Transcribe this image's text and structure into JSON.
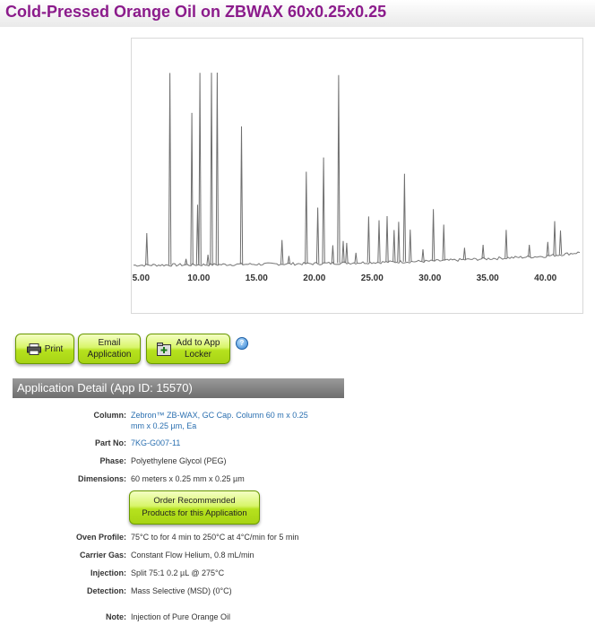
{
  "page": {
    "title": "Cold-Pressed Orange Oil on ZBWAX 60x0.25x0.25"
  },
  "colors": {
    "title": "#8b1b8b",
    "button_green": "#b6e21e",
    "header_gray": "#7a7a7a",
    "link": "#2a6fb0"
  },
  "chart_data": {
    "type": "line",
    "title": "",
    "xlabel": "",
    "ylabel": "",
    "xlim": [
      4.2,
      43.2
    ],
    "x_ticks": [
      "5.00",
      "10.00",
      "15.00",
      "20.00",
      "25.00",
      "30.00",
      "35.00",
      "40.00"
    ],
    "x_tick_values": [
      5,
      10,
      15,
      20,
      25,
      30,
      35,
      40
    ],
    "ylim": [
      0,
      100
    ],
    "grid": false,
    "baseline": [
      [
        4.2,
        1.0
      ],
      [
        10,
        1.2
      ],
      [
        20,
        1.8
      ],
      [
        30,
        3.0
      ],
      [
        40,
        5.5
      ],
      [
        43.2,
        7.5
      ]
    ],
    "peaks": [
      {
        "x": 5.5,
        "h": 16
      },
      {
        "x": 7.5,
        "h": 96
      },
      {
        "x": 8.9,
        "h": 3
      },
      {
        "x": 9.4,
        "h": 76
      },
      {
        "x": 9.9,
        "h": 30
      },
      {
        "x": 10.1,
        "h": 96
      },
      {
        "x": 10.8,
        "h": 5
      },
      {
        "x": 11.1,
        "h": 96
      },
      {
        "x": 11.6,
        "h": 96
      },
      {
        "x": 13.7,
        "h": 69
      },
      {
        "x": 17.2,
        "h": 12
      },
      {
        "x": 17.8,
        "h": 4
      },
      {
        "x": 19.3,
        "h": 46
      },
      {
        "x": 20.3,
        "h": 28
      },
      {
        "x": 20.8,
        "h": 53
      },
      {
        "x": 21.6,
        "h": 9
      },
      {
        "x": 22.1,
        "h": 94
      },
      {
        "x": 22.5,
        "h": 11
      },
      {
        "x": 22.8,
        "h": 10
      },
      {
        "x": 23.6,
        "h": 5
      },
      {
        "x": 24.7,
        "h": 23
      },
      {
        "x": 25.6,
        "h": 21
      },
      {
        "x": 26.3,
        "h": 23
      },
      {
        "x": 26.9,
        "h": 16
      },
      {
        "x": 27.3,
        "h": 20
      },
      {
        "x": 27.8,
        "h": 44
      },
      {
        "x": 28.3,
        "h": 16
      },
      {
        "x": 29.4,
        "h": 6
      },
      {
        "x": 30.3,
        "h": 26
      },
      {
        "x": 31.2,
        "h": 18
      },
      {
        "x": 33.0,
        "h": 6
      },
      {
        "x": 34.6,
        "h": 7
      },
      {
        "x": 36.6,
        "h": 14
      },
      {
        "x": 38.6,
        "h": 6
      },
      {
        "x": 40.2,
        "h": 7
      },
      {
        "x": 40.8,
        "h": 17
      },
      {
        "x": 41.3,
        "h": 12
      }
    ]
  },
  "toolbar": {
    "print_label": "Print",
    "print_icon": "printer-icon",
    "email_label_1": "Email",
    "email_label_2": "Application",
    "locker_label_1": "Add to App",
    "locker_label_2": "Locker",
    "locker_icon": "add-locker-icon",
    "help_icon": "help-icon",
    "help_glyph": "?"
  },
  "detail": {
    "header": "Application Detail (App ID: 15570)",
    "column_label": "Column:",
    "column_value_1": "Zebron™ ZB-WAX, GC Cap. Column 60 m x 0.25",
    "column_value_2": "mm x 0.25 µm, Ea",
    "partno_label": "Part No:",
    "partno_value": "7KG-G007-11",
    "phase_label": "Phase:",
    "phase_value": "Polyethylene Glycol (PEG)",
    "dimensions_label": "Dimensions:",
    "dimensions_value": "60 meters x 0.25 mm x 0.25 µm",
    "order_label_1": "Order Recommended",
    "order_label_2": "Products for this Application",
    "oven_label": "Oven Profile:",
    "oven_value": "75°C to for 4 min to 250°C at 4°C/min for 5 min",
    "carrier_label": "Carrier Gas:",
    "carrier_value": "Constant Flow Helium, 0.8 mL/min",
    "injection_label": "Injection:",
    "injection_value": "Split 75:1 0.2 µL @ 275°C",
    "detection_label": "Detection:",
    "detection_value": "Mass Selective (MSD) (0°C)",
    "note_label": "Note:",
    "note_value": "Injection of Pure Orange Oil"
  }
}
